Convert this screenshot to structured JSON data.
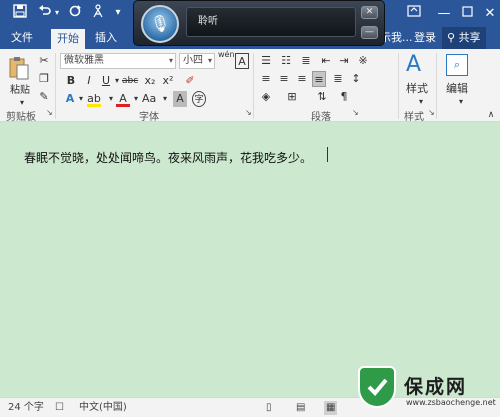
{
  "colors": {
    "brand": "#2b579a",
    "doc_bg": "#cce8cf",
    "watermark_green": "#2f9b48"
  },
  "tabs": [
    {
      "label": "文件"
    },
    {
      "label": "开始"
    },
    {
      "label": "插入"
    },
    {
      "label": "登录"
    },
    {
      "label": "共享"
    }
  ],
  "tabs_partial_hint": "示我...",
  "speech": {
    "status": "聆听"
  },
  "ribbon": {
    "clipboard": {
      "paste_label": "粘贴",
      "group": "剪贴板"
    },
    "font": {
      "name": "微软雅黑",
      "size": "小四",
      "wen": "wén",
      "group": "字体",
      "bold": "B",
      "italic": "I",
      "underline": "U",
      "strike": "abc",
      "sub": "x₂",
      "sup": "x²",
      "aa": "Aa"
    },
    "paragraph": {
      "group": "段落"
    },
    "styles": {
      "label": "样式",
      "group": "样式"
    },
    "editing": {
      "label": "编辑"
    }
  },
  "document": {
    "text": "春眠不觉晓，处处闻啼鸟。夜来风雨声，花我吃多少。"
  },
  "status": {
    "words": "24 个字",
    "language": "中文(中国)"
  },
  "watermark": {
    "title": "保成网",
    "url": "www.zsbaochenge.net"
  }
}
